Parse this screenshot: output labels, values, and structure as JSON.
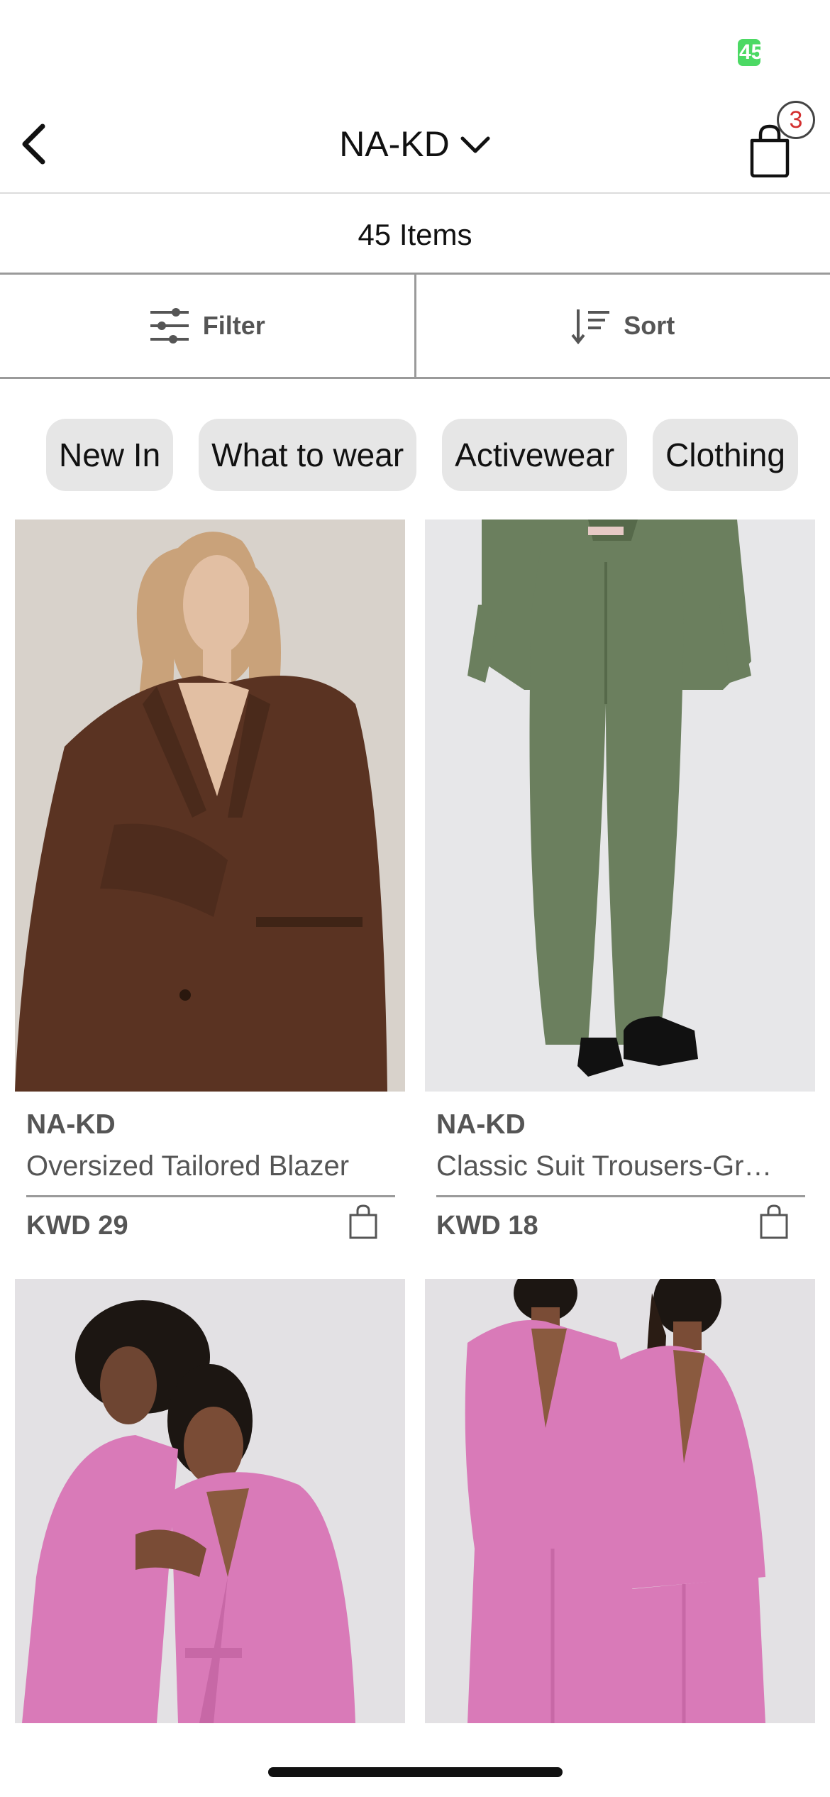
{
  "status_bar": {
    "battery_text": "45"
  },
  "header": {
    "title": "NA-KD",
    "cart_count": "3"
  },
  "results": {
    "count_label": "45 Items"
  },
  "toolbar": {
    "filter_label": "Filter",
    "sort_label": "Sort"
  },
  "chips": [
    "New In",
    "What to wear",
    "Activewear",
    "Clothing"
  ],
  "products": [
    {
      "brand": "NA-KD",
      "name": "Oversized Tailored Blazer",
      "price": "KWD 29"
    },
    {
      "brand": "NA-KD",
      "name": "Classic Suit Trousers-Gr…",
      "price": "KWD 18"
    },
    {
      "brand": "",
      "name": "",
      "price": ""
    },
    {
      "brand": "",
      "name": "",
      "price": ""
    }
  ],
  "colors": {
    "accent_badge": "#d32f2f",
    "chip_bg": "#e6e6e6",
    "brown_blazer": "#5a3322",
    "green_suit": "#6b7f5e",
    "pink_suit": "#d97ab8"
  }
}
